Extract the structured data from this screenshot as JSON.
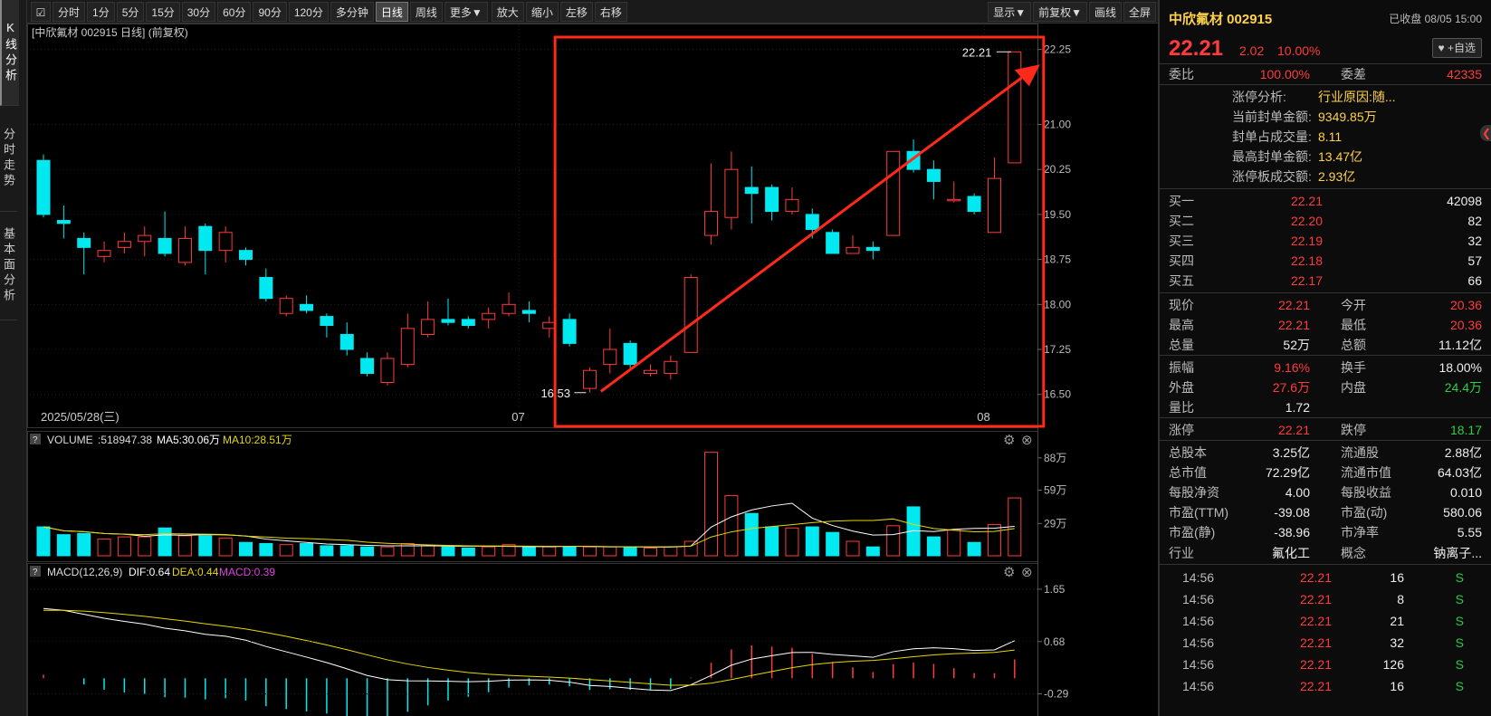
{
  "left_tabs": [
    "K线分析",
    "分时走势",
    "基本面分析"
  ],
  "toolbar": {
    "periods": [
      "分时",
      "1分",
      "5分",
      "15分",
      "30分",
      "60分",
      "90分",
      "120分",
      "多分钟",
      "日线",
      "周线",
      "更多▼"
    ],
    "active_period": "日线",
    "actions": [
      "放大",
      "缩小",
      "左移",
      "右移"
    ],
    "right": [
      "显示▼",
      "前复权▼",
      "画线",
      "全屏"
    ]
  },
  "chart": {
    "title": "[中欣氟材 002915 日线]  (前复权)",
    "y_ticks": [
      "22.25",
      "21.00",
      "20.25",
      "19.50",
      "18.75",
      "18.00",
      "17.25",
      "16.50"
    ],
    "x_labels": [
      "2025/05/28(三)",
      "07",
      "08"
    ],
    "high_annotation": "22.21",
    "low_annotation": "16.53",
    "volume_label": "VOLUME",
    "volume_value": ":518947.38",
    "volume_ma5": "MA5:30.06万",
    "volume_ma10": "MA10:28.51万",
    "volume_ticks": [
      "88万",
      "59万",
      "29万"
    ],
    "macd_label": "MACD(12,26,9)",
    "macd_dif": "DIF:0.64",
    "macd_dea": "DEA:0.44",
    "macd_macd": "MACD:0.39",
    "macd_ticks": [
      "1.65",
      "0.68",
      "-0.29"
    ],
    "colors": {
      "up": "#ff3b3b",
      "down": "#00e8f0",
      "ma5": "#ffffff",
      "ma10": "#e6d800",
      "annotation": "#ff2a1a"
    }
  },
  "chart_data": {
    "type": "candlestick",
    "title": "中欣氟材 002915 日线",
    "ylim": [
      16.3,
      22.35
    ],
    "candles": [
      {
        "o": 20.4,
        "c": 19.5,
        "h": 20.5,
        "l": 19.45
      },
      {
        "o": 19.4,
        "c": 19.35,
        "h": 19.65,
        "l": 19.1
      },
      {
        "o": 19.1,
        "c": 18.95,
        "h": 19.2,
        "l": 18.5
      },
      {
        "o": 18.8,
        "c": 18.9,
        "h": 19.05,
        "l": 18.7
      },
      {
        "o": 18.95,
        "c": 19.05,
        "h": 19.2,
        "l": 18.85
      },
      {
        "o": 19.05,
        "c": 19.15,
        "h": 19.3,
        "l": 18.8
      },
      {
        "o": 19.1,
        "c": 18.85,
        "h": 19.55,
        "l": 18.8
      },
      {
        "o": 18.7,
        "c": 19.1,
        "h": 19.3,
        "l": 18.65
      },
      {
        "o": 19.3,
        "c": 18.9,
        "h": 19.35,
        "l": 18.5
      },
      {
        "o": 18.9,
        "c": 19.2,
        "h": 19.3,
        "l": 18.7
      },
      {
        "o": 18.9,
        "c": 18.75,
        "h": 18.95,
        "l": 18.65
      },
      {
        "o": 18.45,
        "c": 18.1,
        "h": 18.6,
        "l": 18.05
      },
      {
        "o": 17.85,
        "c": 18.1,
        "h": 18.15,
        "l": 17.8
      },
      {
        "o": 18.0,
        "c": 17.9,
        "h": 18.15,
        "l": 17.85
      },
      {
        "o": 17.8,
        "c": 17.65,
        "h": 17.85,
        "l": 17.45
      },
      {
        "o": 17.5,
        "c": 17.25,
        "h": 17.7,
        "l": 17.15
      },
      {
        "o": 17.1,
        "c": 16.85,
        "h": 17.2,
        "l": 16.8
      },
      {
        "o": 16.7,
        "c": 17.1,
        "h": 17.2,
        "l": 16.65
      },
      {
        "o": 17.0,
        "c": 17.6,
        "h": 17.85,
        "l": 16.95
      },
      {
        "o": 17.5,
        "c": 17.75,
        "h": 18.05,
        "l": 17.45
      },
      {
        "o": 17.75,
        "c": 17.7,
        "h": 18.1,
        "l": 17.65
      },
      {
        "o": 17.75,
        "c": 17.65,
        "h": 17.8,
        "l": 17.6
      },
      {
        "o": 17.75,
        "c": 17.85,
        "h": 17.95,
        "l": 17.6
      },
      {
        "o": 17.85,
        "c": 18.0,
        "h": 18.2,
        "l": 17.8
      },
      {
        "o": 17.9,
        "c": 17.85,
        "h": 18.05,
        "l": 17.7
      },
      {
        "o": 17.6,
        "c": 17.7,
        "h": 17.8,
        "l": 17.45
      },
      {
        "o": 17.75,
        "c": 17.35,
        "h": 17.85,
        "l": 17.3
      },
      {
        "o": 16.6,
        "c": 16.9,
        "h": 16.95,
        "l": 16.53
      },
      {
        "o": 17.0,
        "c": 17.25,
        "h": 17.6,
        "l": 16.85
      },
      {
        "o": 17.35,
        "c": 17.0,
        "h": 17.4,
        "l": 16.9
      },
      {
        "o": 16.85,
        "c": 16.9,
        "h": 17.0,
        "l": 16.8
      },
      {
        "o": 16.85,
        "c": 17.05,
        "h": 17.15,
        "l": 16.75
      },
      {
        "o": 17.2,
        "c": 18.45,
        "h": 18.5,
        "l": 17.2
      },
      {
        "o": 19.15,
        "c": 19.55,
        "h": 20.35,
        "l": 19.0
      },
      {
        "o": 19.45,
        "c": 20.25,
        "h": 20.55,
        "l": 19.25
      },
      {
        "o": 19.95,
        "c": 19.85,
        "h": 20.3,
        "l": 19.35
      },
      {
        "o": 19.95,
        "c": 19.55,
        "h": 20.0,
        "l": 19.4
      },
      {
        "o": 19.55,
        "c": 19.75,
        "h": 19.95,
        "l": 19.5
      },
      {
        "o": 19.5,
        "c": 19.25,
        "h": 19.6,
        "l": 19.1
      },
      {
        "o": 19.2,
        "c": 18.85,
        "h": 19.25,
        "l": 18.85
      },
      {
        "o": 18.85,
        "c": 18.95,
        "h": 19.15,
        "l": 18.85
      },
      {
        "o": 18.95,
        "c": 18.9,
        "h": 19.05,
        "l": 18.75
      },
      {
        "o": 19.15,
        "c": 20.55,
        "h": 20.55,
        "l": 19.15
      },
      {
        "o": 20.55,
        "c": 20.25,
        "h": 20.75,
        "l": 20.2
      },
      {
        "o": 20.25,
        "c": 20.05,
        "h": 20.4,
        "l": 19.75
      },
      {
        "o": 19.75,
        "c": 19.75,
        "h": 20.05,
        "l": 19.7
      },
      {
        "o": 19.8,
        "c": 19.55,
        "h": 19.85,
        "l": 19.5
      },
      {
        "o": 19.2,
        "c": 20.1,
        "h": 20.45,
        "l": 19.2
      },
      {
        "o": 20.36,
        "c": 22.21,
        "h": 22.21,
        "l": 20.36
      }
    ],
    "volume_wan": [
      26,
      19,
      20,
      15,
      17,
      17,
      25,
      18,
      18,
      16,
      12,
      11,
      10,
      11,
      9,
      9,
      8,
      8,
      11,
      9,
      8,
      7,
      8,
      10,
      8,
      8,
      8,
      8,
      8,
      8,
      7,
      8,
      13,
      93,
      54,
      38,
      26,
      25,
      26,
      21,
      13,
      8,
      27,
      44,
      17,
      23,
      12,
      28,
      52
    ],
    "volume_ylim": [
      0,
      96
    ],
    "macd_ylim": [
      -0.7,
      1.8
    ]
  },
  "quote": {
    "name": "中欣氟材 002915",
    "status": "已收盘 08/05 15:00",
    "price": "22.21",
    "change": "2.02",
    "pct": "10.00%",
    "fav_label": "+自选",
    "weibi_label": "委比",
    "weibi": "100.00%",
    "weicha_label": "委差",
    "weicha": "42335",
    "limit_analysis": [
      {
        "label": "涨停分析:",
        "value": "行业原因:随..."
      },
      {
        "label": "当前封单金额:",
        "value": "9349.85万"
      },
      {
        "label": "封单占成交量:",
        "value": "8.11"
      },
      {
        "label": "最高封单金额:",
        "value": "13.47亿"
      },
      {
        "label": "涨停板成交额:",
        "value": "2.93亿"
      }
    ],
    "bids": [
      {
        "label": "买一",
        "price": "22.21",
        "vol": "42098"
      },
      {
        "label": "买二",
        "price": "22.20",
        "vol": "82"
      },
      {
        "label": "买三",
        "price": "22.19",
        "vol": "32"
      },
      {
        "label": "买四",
        "price": "22.18",
        "vol": "57"
      },
      {
        "label": "买五",
        "price": "22.17",
        "vol": "66"
      }
    ],
    "stats1": [
      {
        "l1": "现价",
        "v1": "22.21",
        "c1": "red",
        "l2": "今开",
        "v2": "20.36",
        "c2": "red"
      },
      {
        "l1": "最高",
        "v1": "22.21",
        "c1": "red",
        "l2": "最低",
        "v2": "20.36",
        "c2": "red"
      },
      {
        "l1": "总量",
        "v1": "52万",
        "c1": "white",
        "l2": "总额",
        "v2": "11.12亿",
        "c2": "white"
      }
    ],
    "stats2": [
      {
        "l1": "振幅",
        "v1": "9.16%",
        "c1": "red",
        "l2": "换手",
        "v2": "18.00%",
        "c2": "white"
      },
      {
        "l1": "外盘",
        "v1": "27.6万",
        "c1": "red",
        "l2": "内盘",
        "v2": "24.4万",
        "c2": "green"
      },
      {
        "l1": "量比",
        "v1": "1.72",
        "c1": "white",
        "l2": "",
        "v2": "",
        "c2": "white"
      }
    ],
    "limits": {
      "l1": "涨停",
      "v1": "22.21",
      "l2": "跌停",
      "v2": "18.17"
    },
    "stats3": [
      {
        "l1": "总股本",
        "v1": "3.25亿",
        "l2": "流通股",
        "v2": "2.88亿"
      },
      {
        "l1": "总市值",
        "v1": "72.29亿",
        "l2": "流通市值",
        "v2": "64.03亿"
      },
      {
        "l1": "每股净资",
        "v1": "4.00",
        "l2": "每股收益",
        "v2": "0.010"
      },
      {
        "l1": "市盈(TTM)",
        "v1": "-39.08",
        "l2": "市盈(动)",
        "v2": "580.06"
      },
      {
        "l1": "市盈(静)",
        "v1": "-38.96",
        "l2": "市净率",
        "v2": "5.55"
      }
    ],
    "industry_label": "行业",
    "industry": "氟化工",
    "concept_label": "概念",
    "concept": "钠离子...",
    "ticks": [
      {
        "t": "14:56",
        "p": "22.21",
        "v": "16",
        "s": "S"
      },
      {
        "t": "14:56",
        "p": "22.21",
        "v": "8",
        "s": "S"
      },
      {
        "t": "14:56",
        "p": "22.21",
        "v": "21",
        "s": "S"
      },
      {
        "t": "14:56",
        "p": "22.21",
        "v": "32",
        "s": "S"
      },
      {
        "t": "14:56",
        "p": "22.21",
        "v": "126",
        "s": "S"
      },
      {
        "t": "14:56",
        "p": "22.21",
        "v": "16",
        "s": "S"
      }
    ]
  }
}
